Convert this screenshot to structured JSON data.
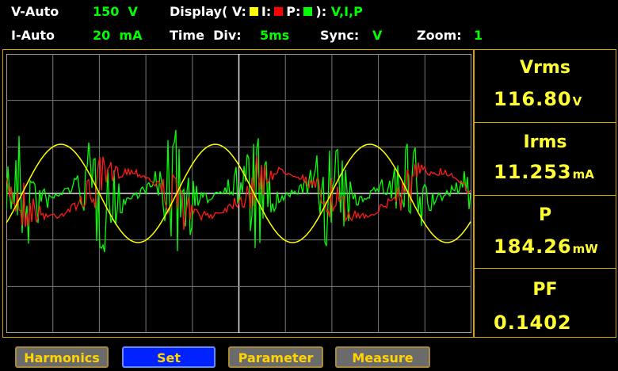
{
  "header": {
    "v_mode": "V-Auto",
    "v_range": "150  V",
    "display_label": "Display( V:",
    "display_i": "I:",
    "display_p": "P:",
    "display_close": "):",
    "display_value": "V,I,P",
    "i_mode": "I-Auto",
    "i_range": "20  mA",
    "time_div_label": "Time  Div:",
    "time_div_value": "5ms",
    "sync_label": "Sync:",
    "sync_value": "V",
    "zoom_label": "Zoom:",
    "zoom_value": "1"
  },
  "colors": {
    "voltage": "#ffff00",
    "current": "#ff0000",
    "power": "#00ff00",
    "accent": "#d8a000"
  },
  "readouts": [
    {
      "label": "Vrms",
      "value": "116.80",
      "unit": "V"
    },
    {
      "label": "Irms",
      "value": "11.253",
      "unit": "mA"
    },
    {
      "label": "P",
      "value": "184.26",
      "unit": "mW"
    },
    {
      "label": "PF",
      "value": "0.1402",
      "unit": ""
    }
  ],
  "tabs": [
    {
      "label": "Harmonics",
      "active": false
    },
    {
      "label": "Set",
      "active": true
    },
    {
      "label": "Parameter",
      "active": false
    },
    {
      "label": "Measure",
      "active": false
    }
  ]
}
